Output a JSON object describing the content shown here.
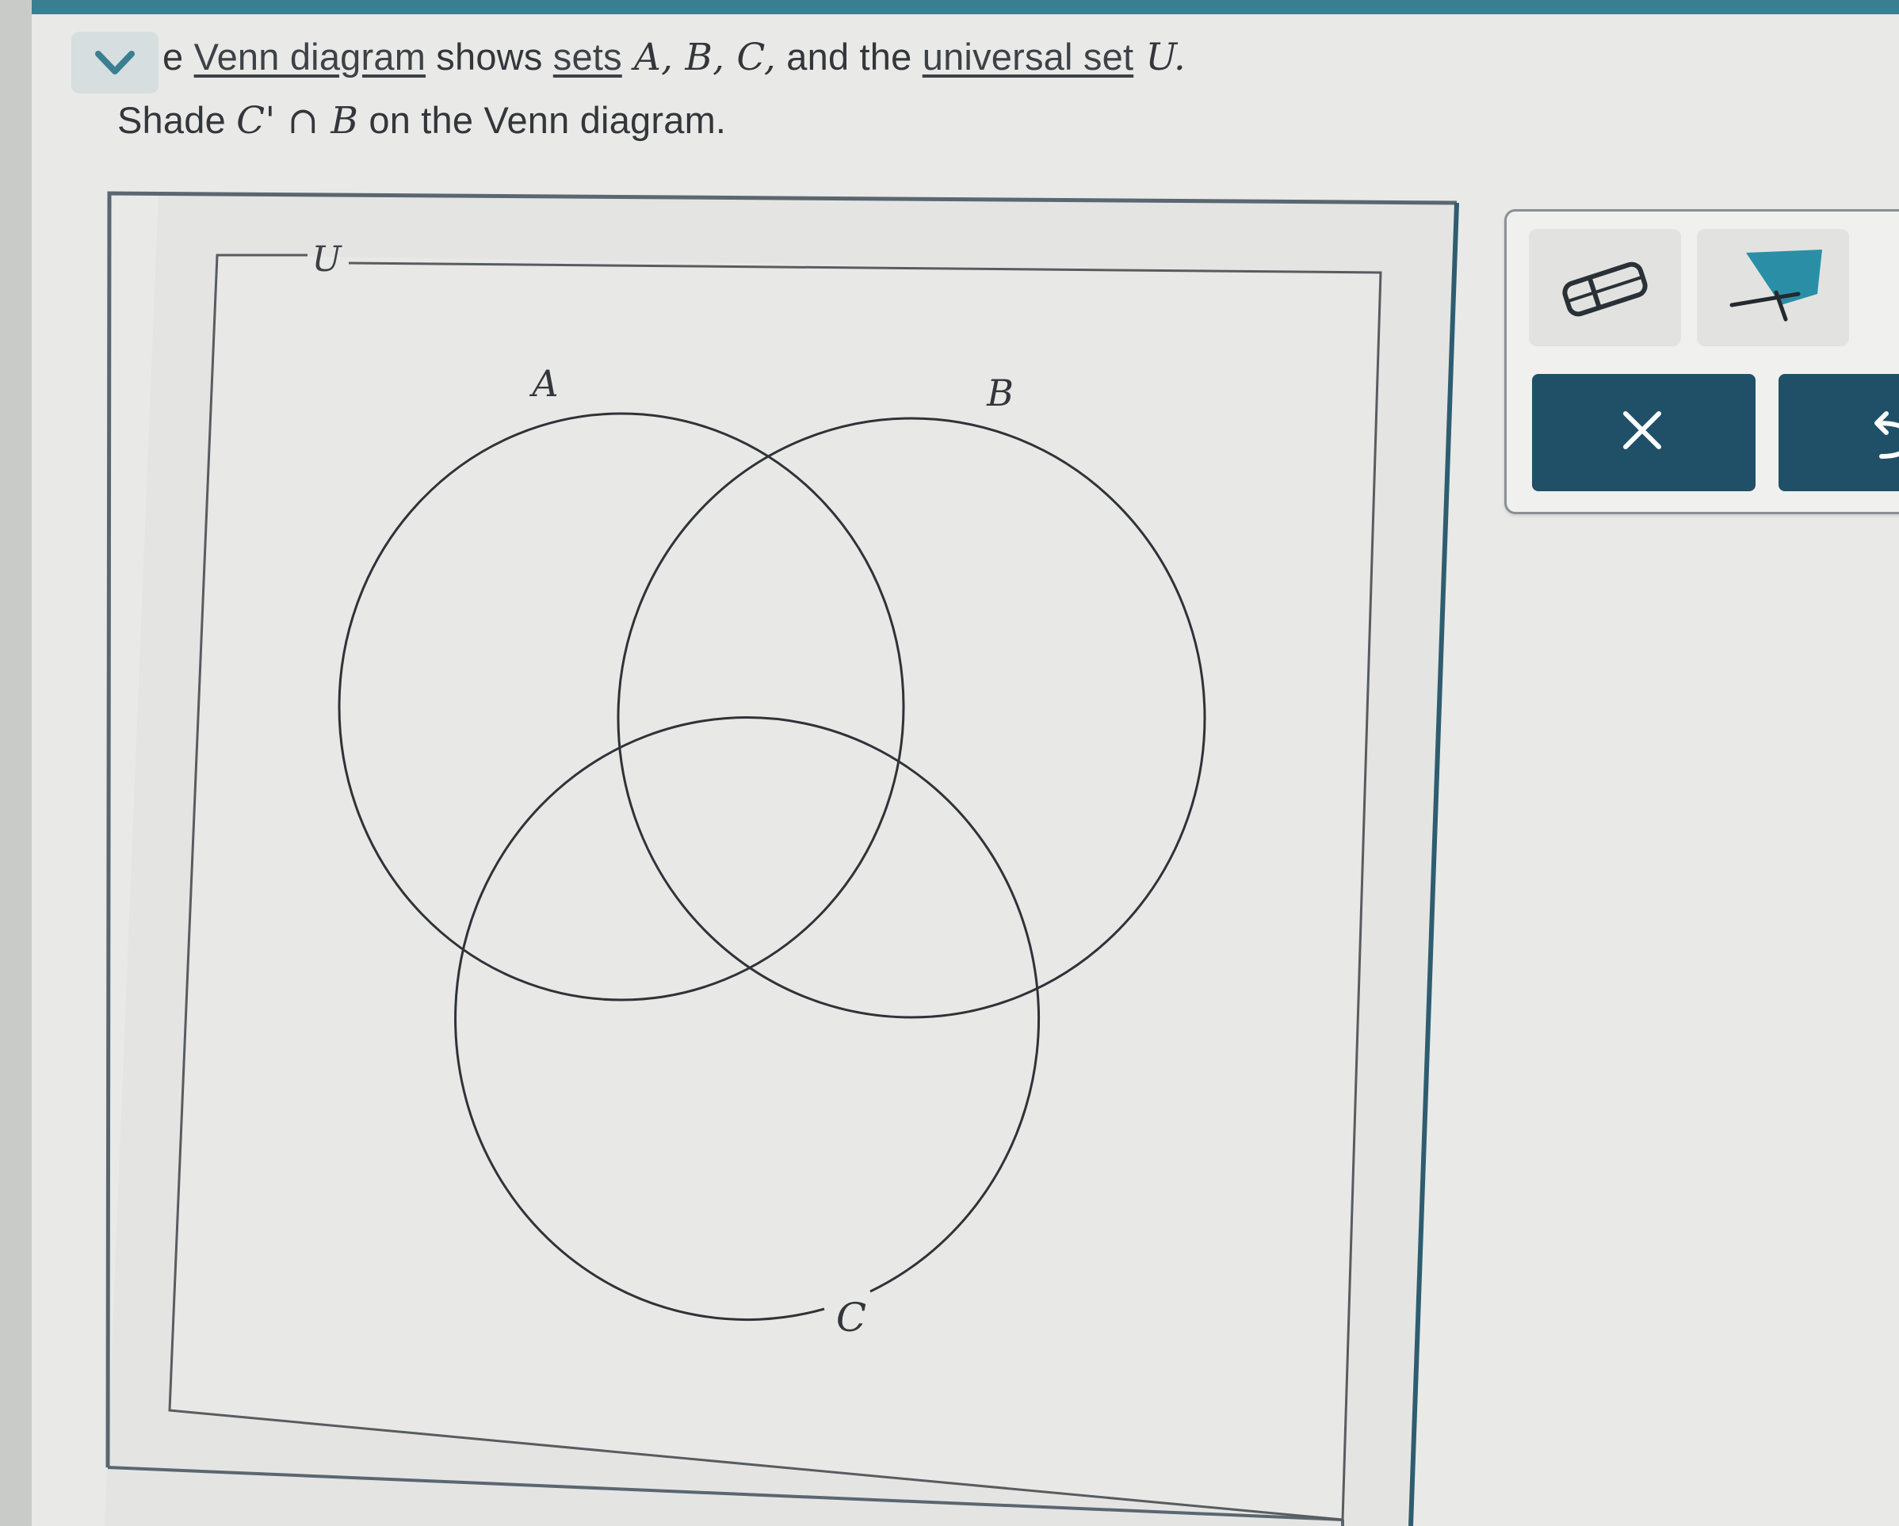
{
  "question": {
    "line1": {
      "lead": "e",
      "venn_link": "Venn diagram",
      "shows": " shows ",
      "sets_link": "sets",
      "set_list": " A, B, C,",
      "and_the": " and the ",
      "universal_link": "universal set",
      "u_symbol": " U."
    },
    "line2": {
      "shade": "Shade ",
      "expr_c": "C",
      "expr_prime": "'",
      "expr_op": " ∩ ",
      "expr_b": "B",
      "rest": " on the Venn diagram."
    }
  },
  "venn": {
    "universe_label": "U",
    "set_labels": {
      "a": "A",
      "b": "B",
      "c": "C"
    }
  },
  "toolbar": {
    "eraser_icon": "eraser-icon",
    "shade_icon": "shading-pen-icon",
    "clear_label": "×",
    "undo_icon": "undo-arrow-icon",
    "accent_color": "#2a8fa6",
    "button_color": "#1f5068"
  }
}
